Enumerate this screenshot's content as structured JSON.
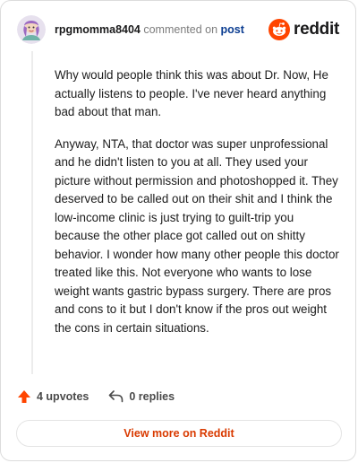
{
  "comment": {
    "username": "rpgmomma8404",
    "verb": "commented on",
    "post_link": "post",
    "paragraphs": [
      "Why would people think this was about Dr. Now, He actually listens to people. I've never heard anything bad about that man.",
      "Anyway, NTA, that doctor was super unprofessional and he didn't listen to you at all. They used your picture without permission and photoshopped it. They deserved to be called out on their shit and I think the low-income clinic is just trying to guilt-trip you because the other place got called out on shitty behavior. I wonder how many other people this doctor treated like this. Not everyone who wants to lose weight wants gastric bypass surgery. There are pros and cons to it but I don't know if the pros out weight the cons in certain situations."
    ]
  },
  "brand": {
    "name": "reddit",
    "icon": "reddit-logo-icon",
    "color": "#ff4500"
  },
  "actions": {
    "upvotes": "4 upvotes",
    "replies": "0 replies",
    "upvote_icon": "upvote-arrow-icon",
    "reply_icon": "reply-arrow-icon"
  },
  "footer": {
    "view_more": "View more on Reddit"
  },
  "colors": {
    "accent": "#ff4500",
    "link": "#0b3d91",
    "cta": "#d93a00"
  }
}
